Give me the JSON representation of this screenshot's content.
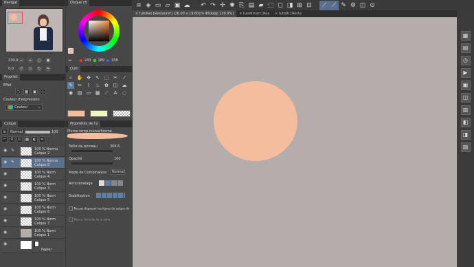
{
  "navigator": {
    "title": "Navigat",
    "zoom": "139.9",
    "rotation": "0.0"
  },
  "color_wheel": {
    "title": "Disque ch",
    "rgb_r": "243",
    "rgb_g": "189",
    "rgb_b": "158"
  },
  "properties": {
    "title": "Propriét",
    "effect_label": "Effet",
    "expression_label": "Couleur d'expression",
    "expression_value": "Couleur"
  },
  "tools": {
    "title": "Outil"
  },
  "layers": {
    "title": "Calque",
    "blend_mode": "Normal",
    "opacity": "100",
    "items": [
      {
        "pct": "100 %",
        "mode": "Norma",
        "name": "Calque 2"
      },
      {
        "pct": "100 %",
        "mode": "Norma",
        "name": "Calque 8"
      },
      {
        "pct": "100 %",
        "mode": "Norm",
        "name": "Calque 4"
      },
      {
        "pct": "100 %",
        "mode": "Norm",
        "name": "Calque 3"
      },
      {
        "pct": "100 %",
        "mode": "Norm",
        "name": "Calque 5"
      },
      {
        "pct": "100 %",
        "mode": "Norm",
        "name": "Calque 6"
      },
      {
        "pct": "100 %",
        "mode": "Norm",
        "name": "Calque 7"
      },
      {
        "pct": "100 %",
        "mode": "Norm",
        "name": "Calque 1"
      },
      {
        "pct": "",
        "mode": "",
        "name": "Papier"
      }
    ]
  },
  "tool_props": {
    "title": "Propriétés de l'o",
    "brush_name": "Plume remp.monochrome",
    "size_label": "Taille de pinceau",
    "size_value": "309.5",
    "opacity_label": "Opacité",
    "opacity_value": "100",
    "blend_label": "Mode de Combinaison",
    "blend_value": "Normal",
    "aa_label": "Anticrénelage",
    "stab_label": "Stabilisation",
    "no_overlap_label": "Ne pas dépasser les lignes du calque de",
    "scale_label": "Mise à l'échelle de la zone"
  },
  "tabs": [
    {
      "label": "tutoRat [Restaurer] (26.00 x 19.60cm 450ppp 139.9%)"
    },
    {
      "label": "tutoRmart [Res"
    },
    {
      "label": "tutoRt [Resta"
    }
  ],
  "colors": {
    "accent": "#5a6f8c",
    "canvas": "#b5adab",
    "circle": "#f3bd9e",
    "dark": "#2f2f2f"
  }
}
